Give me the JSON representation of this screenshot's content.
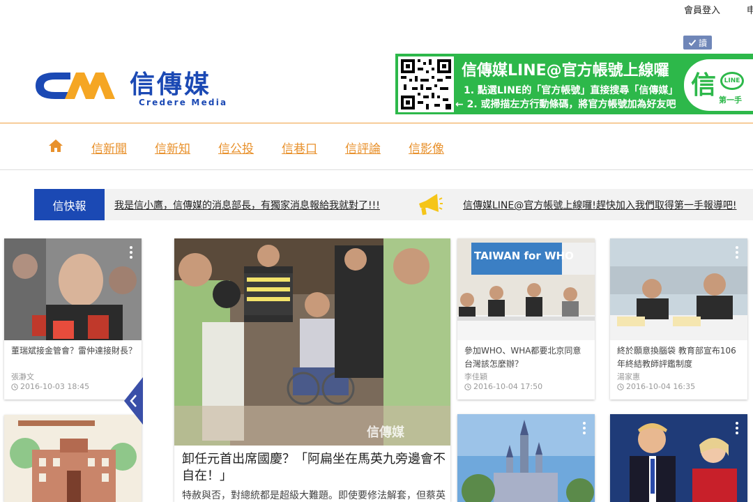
{
  "topbar": {
    "login": "會員登入",
    "cut_link": "申"
  },
  "read_badge": {
    "label": "讀",
    "icon": "check-icon"
  },
  "header": {
    "logo_text": "信傳媒",
    "logo_sub": "Credere Media",
    "brand_colors": {
      "blue": "#1b49b4",
      "orange": "#f5a623"
    }
  },
  "banner": {
    "title": "信傳媒LINE@官方帳號上線囉",
    "line1": "1. 點選LINE的「官方帳號」直接搜尋「信傳媒」",
    "line2": "← 2. 或掃描左方行動條碼，將官方帳號加為好友吧",
    "badge_char": "信",
    "badge_line": "LINE",
    "badge_sub": "第一手",
    "bg_color": "#2db84a"
  },
  "nav": {
    "home_icon": "home-icon",
    "items": [
      "信新聞",
      "信新知",
      "信公投",
      "信巷口",
      "信評論",
      "信影像"
    ],
    "color": "#e8912c"
  },
  "ticker": {
    "label": "信快報",
    "message1": "我是信小鷹，信傳媒的消息部長，有獨家消息報給我就對了!!!",
    "megaphone_icon": "megaphone-icon",
    "message2": "信傳媒LINE@官方帳號上線囉!趕快加入我們取得第一手報導吧!"
  },
  "cards": {
    "left_top": {
      "title": "董瑞斌接金管會？雷仲達接財長？",
      "author": "張瀞文",
      "date": "2016-10-03 18:45"
    },
    "feature": {
      "title": "卸任元首出席國慶？「阿扁坐在馬英九旁邊會不自在！」",
      "excerpt": "特赦與否，對總統都是超級大難題。即使要修法解套，但蔡英",
      "watermark": "信傳媒"
    },
    "who": {
      "title": "參加WHO、WHA都要北京同意 台灣該怎麼辦？",
      "author": "李佳穎",
      "date": "2016-10-04 17:50",
      "photo_banner": "TAIWAN for WHO"
    },
    "teacher": {
      "title": "終於願意換腦袋 教育部宣布106年終結教師評鑑制度",
      "author": "湯家惠",
      "date": "2016-10-04 16:35"
    }
  }
}
